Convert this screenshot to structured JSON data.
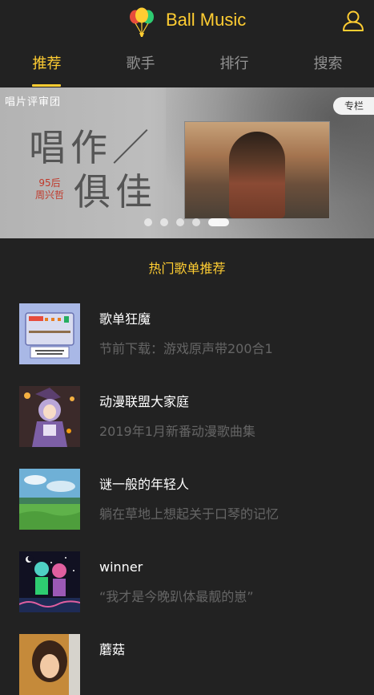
{
  "header": {
    "title": "Ball Music",
    "logo_icon": "balloons-icon",
    "user_icon": "user-icon",
    "accent_color": "#ffcd32",
    "background_color": "#222222"
  },
  "tabs": [
    {
      "label": "推荐",
      "active": true
    },
    {
      "label": "歌手",
      "active": false
    },
    {
      "label": "排行",
      "active": false
    },
    {
      "label": "搜索",
      "active": false
    }
  ],
  "banner": {
    "brand": "唱片评审团",
    "headline_line1": "唱作／",
    "headline_line2": "俱佳",
    "subtitle_line1": "95后",
    "subtitle_line2": "周兴哲",
    "badge": "专栏",
    "slide_count": 5,
    "active_slide": 5
  },
  "section": {
    "title": "热门歌单推荐"
  },
  "playlists": [
    {
      "title": "歌单狂魔",
      "description": "节前下载：游戏原声带200合1"
    },
    {
      "title": "动漫联盟大家庭",
      "description": "2019年1月新番动漫歌曲集"
    },
    {
      "title": "谜一般的年轻人",
      "description": "躺在草地上想起关于口琴的记忆"
    },
    {
      "title": "winner",
      "description": "“我才是今晚趴体最靓的崽”"
    },
    {
      "title": "蘑菇",
      "description": ""
    }
  ]
}
